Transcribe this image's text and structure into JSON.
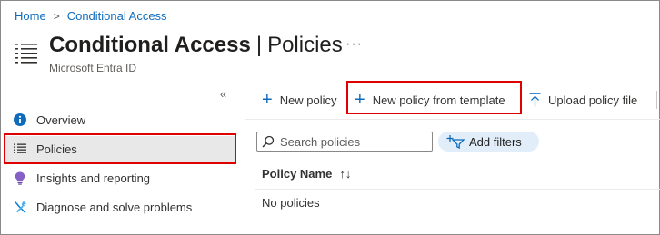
{
  "breadcrumb": {
    "home": "Home",
    "separator": ">",
    "current": "Conditional Access"
  },
  "header": {
    "title_bold": "Conditional Access",
    "title_sep": "|",
    "title_page": "Policies",
    "more": "···",
    "subtitle": "Microsoft Entra ID"
  },
  "sidebar": {
    "collapse": "«",
    "items": [
      {
        "label": "Overview",
        "icon": "info-icon"
      },
      {
        "label": "Policies",
        "icon": "list-icon",
        "selected": true
      },
      {
        "label": "Insights and reporting",
        "icon": "lightbulb-icon"
      },
      {
        "label": "Diagnose and solve problems",
        "icon": "wrench-icon"
      }
    ]
  },
  "toolbar": {
    "new_policy": "New policy",
    "new_from_template": "New policy from template",
    "upload": "Upload policy file"
  },
  "filters": {
    "search_placeholder": "Search policies",
    "add_filters": "Add filters"
  },
  "table": {
    "column": "Policy Name",
    "sort_icon": "↑↓",
    "empty": "No policies"
  },
  "colors": {
    "link": "#0f6cbd",
    "highlight": "#e00000",
    "selected_bg": "#e8e8e8",
    "pill_bg": "#e1eef9"
  }
}
